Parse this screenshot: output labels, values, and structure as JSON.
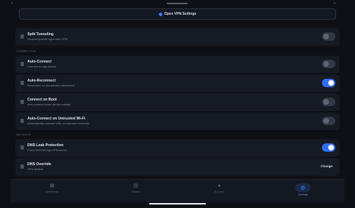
{
  "header": {
    "button_label": "Open VPN Settings"
  },
  "sections": {
    "connection": "CONNECTION",
    "security": "SECURITY"
  },
  "rows": {
    "split_tunneling": {
      "title": "Split Tunneling",
      "desc": "Exclude specific apps from VPN",
      "on": false
    },
    "auto_connect": {
      "title": "Auto-Connect",
      "desc": "Connect on app launch",
      "on": false
    },
    "auto_reconnect": {
      "title": "Auto-Reconnect",
      "desc": "Reconnect on unexpected disconnect",
      "on": true
    },
    "connect_on_boot": {
      "title": "Connect on Boot",
      "desc": "Auto-connect when device restarts",
      "on": false
    },
    "auto_connect_untrusted": {
      "title": "Auto-Connect on Untrusted Wi-Fi",
      "desc": "Automatically connect VPN on unknown networks",
      "on": false
    },
    "dns_leak": {
      "title": "DNS Leak Protection",
      "desc": "Force DNS through VPN tunnel",
      "on": true
    },
    "dns_override": {
      "title": "DNS Override",
      "desc": "VPN Default",
      "action": "Change"
    }
  },
  "nav": [
    {
      "label": "Dashboard",
      "icon": "grid-icon",
      "active": false
    },
    {
      "label": "Servers",
      "icon": "server-icon",
      "active": false
    },
    {
      "label": "Account",
      "icon": "person-icon",
      "active": false
    },
    {
      "label": "Settings",
      "icon": "gear-icon",
      "active": true
    }
  ],
  "colors": {
    "accent": "#2f6df6",
    "background": "#0e1016",
    "card": "#161a22"
  }
}
